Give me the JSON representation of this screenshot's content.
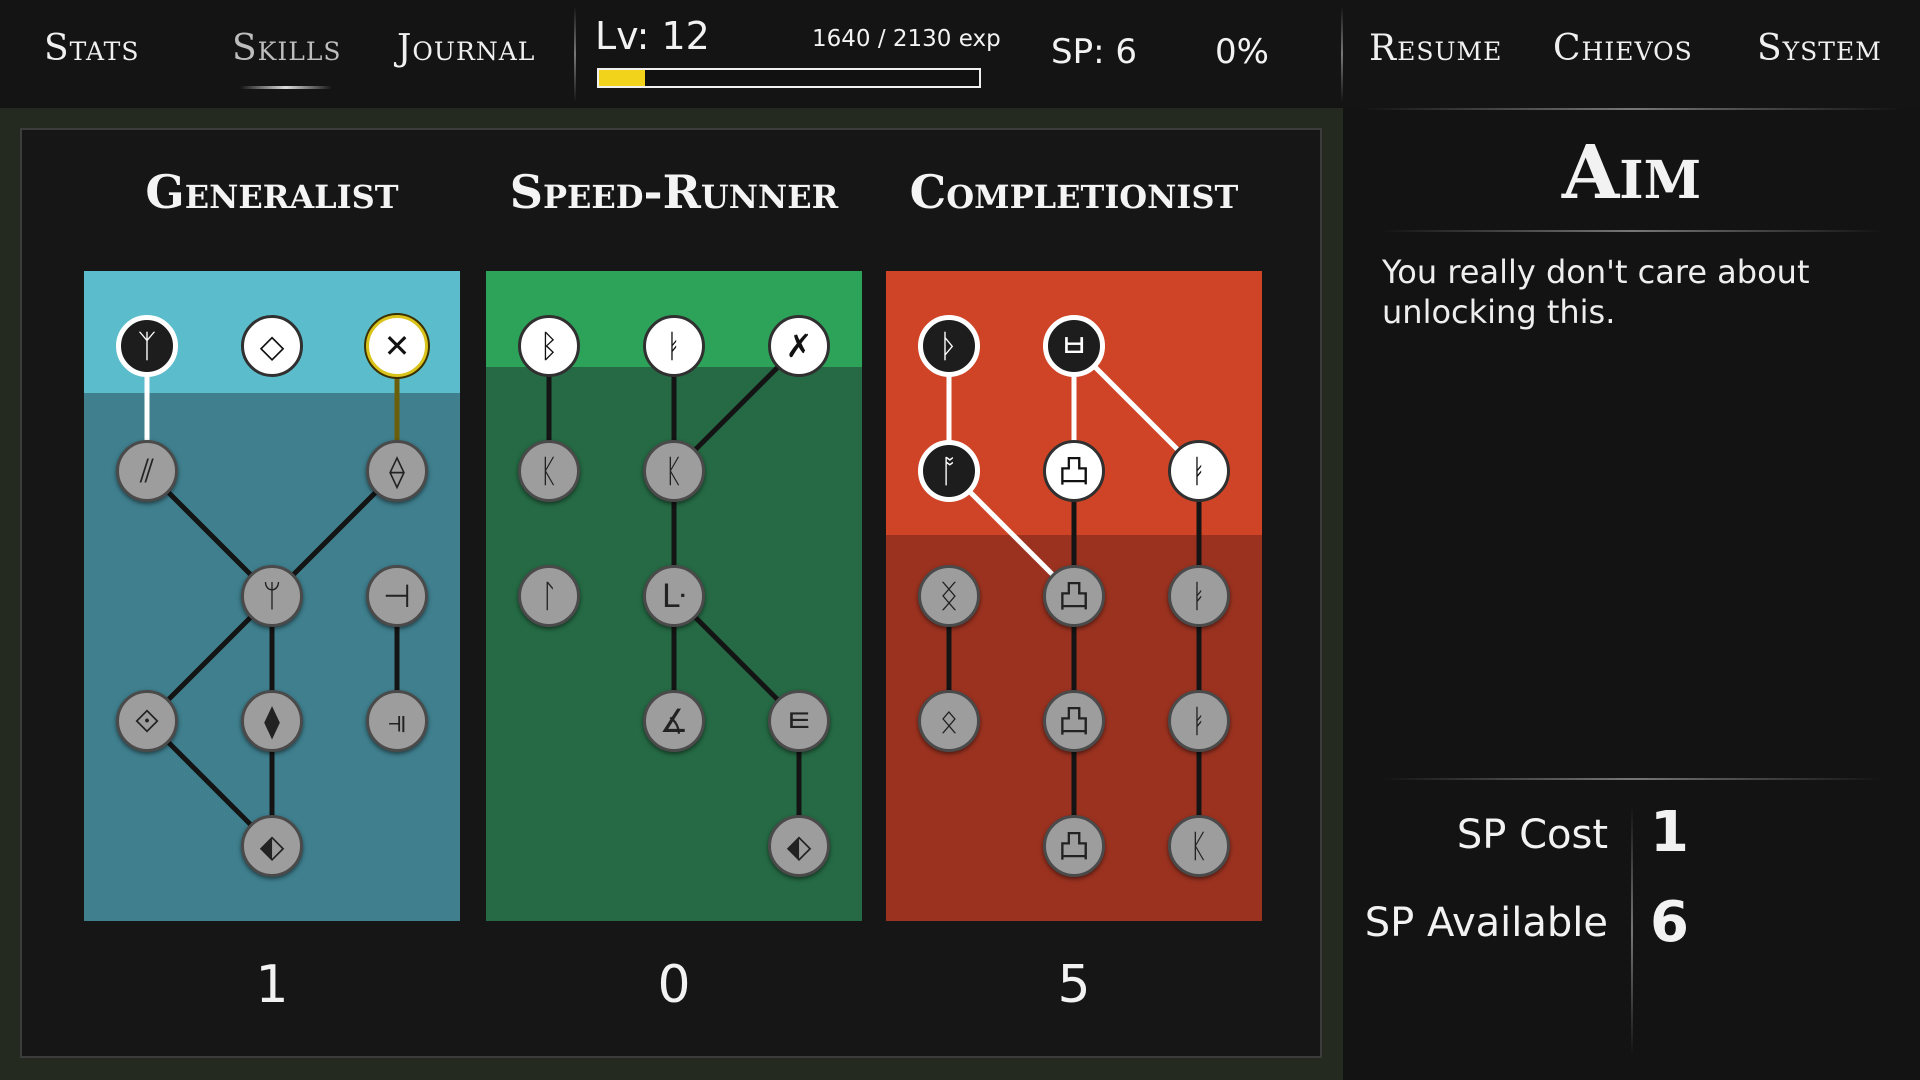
{
  "nav": {
    "stats": "Stats",
    "skills": "Skills",
    "journal": "Journal",
    "resume": "Resume",
    "chievos": "Chievos",
    "system": "System"
  },
  "status": {
    "level": "Lv: 12",
    "exp_text": "1640 / 2130 exp",
    "exp_fraction": 0.12,
    "sp": "SP: 6",
    "percent": "0%",
    "bar_color": "#f2d31b"
  },
  "trees": [
    {
      "title": "Generalist",
      "count": "1",
      "top_color": "#5bbdcc",
      "body_color": "#3f7f8e",
      "band_height": 122,
      "nodes": [
        {
          "id": "g1",
          "col": 0,
          "row": 0,
          "state": "unlocked",
          "icon": "rune-psi-icon",
          "glyph": "ᛉ"
        },
        {
          "id": "g2",
          "col": 1,
          "row": 0,
          "state": "available",
          "icon": "rune-diamond-icon",
          "glyph": "◇"
        },
        {
          "id": "g3",
          "col": 2,
          "row": 0,
          "state": "selected",
          "icon": "rune-cross-icon",
          "glyph": "✕"
        },
        {
          "id": "g4",
          "col": 0,
          "row": 1,
          "state": "locked",
          "icon": "rune-slashes-icon",
          "glyph": "⫽"
        },
        {
          "id": "g5",
          "col": 2,
          "row": 1,
          "state": "locked",
          "icon": "rune-diamond-hatched-icon",
          "glyph": "⟠"
        },
        {
          "id": "g6",
          "col": 1,
          "row": 2,
          "state": "locked",
          "icon": "rune-fork-icon",
          "glyph": "ᛘ"
        },
        {
          "id": "g7",
          "col": 2,
          "row": 2,
          "state": "locked",
          "icon": "rune-tee-icon",
          "glyph": "⊣"
        },
        {
          "id": "g8",
          "col": 0,
          "row": 3,
          "state": "locked",
          "icon": "rune-diamond-cross-icon",
          "glyph": "⟐"
        },
        {
          "id": "g9",
          "col": 1,
          "row": 3,
          "state": "locked",
          "icon": "rune-diamond-bars-icon",
          "glyph": "⧫"
        },
        {
          "id": "g10",
          "col": 2,
          "row": 3,
          "state": "locked",
          "icon": "rune-double-tee-icon",
          "glyph": "⫣"
        },
        {
          "id": "g11",
          "col": 1,
          "row": 4,
          "state": "locked",
          "icon": "rune-diamond-slash-icon",
          "glyph": "⬖"
        }
      ],
      "links": [
        [
          "g1",
          "g4"
        ],
        [
          "g3",
          "g5"
        ],
        [
          "g4",
          "g6"
        ],
        [
          "g5",
          "g6"
        ],
        [
          "g6",
          "g8"
        ],
        [
          "g6",
          "g9"
        ],
        [
          "g7",
          "g10"
        ],
        [
          "g9",
          "g11"
        ],
        [
          "g8",
          "g11"
        ]
      ],
      "active_links": [
        [
          "g1",
          "g4"
        ]
      ],
      "selected_links": [
        [
          "g3",
          "g5"
        ]
      ]
    },
    {
      "title": "Speed-Runner",
      "count": "0",
      "top_color": "#2da35a",
      "body_color": "#256a44",
      "band_height": 96,
      "nodes": [
        {
          "id": "s1",
          "col": 0,
          "row": 0,
          "state": "available",
          "icon": "rune-beta-icon",
          "glyph": "ᛒ"
        },
        {
          "id": "s2",
          "col": 1,
          "row": 0,
          "state": "available",
          "icon": "rune-six-icon",
          "glyph": "ᛓ"
        },
        {
          "id": "s3",
          "col": 2,
          "row": 0,
          "state": "available",
          "icon": "rune-star-icon",
          "glyph": "✗"
        },
        {
          "id": "s4",
          "col": 0,
          "row": 1,
          "state": "locked",
          "icon": "rune-k-icon",
          "glyph": "ᛕ"
        },
        {
          "id": "s5",
          "col": 1,
          "row": 1,
          "state": "locked",
          "icon": "rune-kx-icon",
          "glyph": "ᛕ"
        },
        {
          "id": "s6",
          "col": 0,
          "row": 2,
          "state": "locked",
          "icon": "rune-hook-icon",
          "glyph": "ᛚ"
        },
        {
          "id": "s7",
          "col": 1,
          "row": 2,
          "state": "locked",
          "icon": "rune-corner-icon",
          "glyph": "ᒷ"
        },
        {
          "id": "s8",
          "col": 1,
          "row": 3,
          "state": "locked",
          "icon": "rune-angle-icon",
          "glyph": "∡"
        },
        {
          "id": "s9",
          "col": 2,
          "row": 3,
          "state": "locked",
          "icon": "rune-box-e-icon",
          "glyph": "ㅌ"
        },
        {
          "id": "s10",
          "col": 2,
          "row": 4,
          "state": "locked",
          "icon": "rune-diamond-slash-icon",
          "glyph": "⬖"
        }
      ],
      "links": [
        [
          "s1",
          "s4"
        ],
        [
          "s2",
          "s5"
        ],
        [
          "s3",
          "s5"
        ],
        [
          "s5",
          "s7"
        ],
        [
          "s7",
          "s8"
        ],
        [
          "s7",
          "s9"
        ],
        [
          "s9",
          "s10"
        ]
      ],
      "active_links": [],
      "selected_links": []
    },
    {
      "title": "Completionist",
      "count": "5",
      "top_color": "#cf4426",
      "body_color": "#9b3220",
      "band_height": 264,
      "nodes": [
        {
          "id": "c1",
          "col": 0,
          "row": 0,
          "state": "unlocked",
          "icon": "rune-hook-icon",
          "glyph": "ᚦ"
        },
        {
          "id": "c2",
          "col": 1,
          "row": 0,
          "state": "unlocked",
          "icon": "rune-box-u-icon",
          "glyph": "ㅂ"
        },
        {
          "id": "c3",
          "col": 0,
          "row": 1,
          "state": "unlocked",
          "icon": "rune-hook-arrow-icon",
          "glyph": "ᚩ"
        },
        {
          "id": "c4",
          "col": 1,
          "row": 1,
          "state": "available",
          "icon": "rune-box-flag-icon",
          "glyph": "凸"
        },
        {
          "id": "c5",
          "col": 2,
          "row": 1,
          "state": "available",
          "icon": "rune-six-icon",
          "glyph": "ᛓ"
        },
        {
          "id": "c6",
          "col": 0,
          "row": 2,
          "state": "locked",
          "icon": "rune-hourglass-icon",
          "glyph": "ᛝ"
        },
        {
          "id": "c7",
          "col": 1,
          "row": 2,
          "state": "locked",
          "icon": "rune-box-flag-x-icon",
          "glyph": "凸"
        },
        {
          "id": "c8",
          "col": 2,
          "row": 2,
          "state": "locked",
          "icon": "rune-six-bar-icon",
          "glyph": "ᛓ"
        },
        {
          "id": "c9",
          "col": 0,
          "row": 3,
          "state": "locked",
          "icon": "rune-diamond-x-icon",
          "glyph": "ᛟ"
        },
        {
          "id": "c10",
          "col": 1,
          "row": 3,
          "state": "locked",
          "icon": "rune-box-flag-slash-icon",
          "glyph": "凸"
        },
        {
          "id": "c11",
          "col": 2,
          "row": 3,
          "state": "locked",
          "icon": "rune-six-slash-icon",
          "glyph": "ᛓ"
        },
        {
          "id": "c12",
          "col": 1,
          "row": 4,
          "state": "locked",
          "icon": "rune-box-flag-dot-icon",
          "glyph": "凸"
        },
        {
          "id": "c13",
          "col": 2,
          "row": 4,
          "state": "locked",
          "icon": "rune-box-k-icon",
          "glyph": "ᛕ"
        }
      ],
      "links": [
        [
          "c1",
          "c3"
        ],
        [
          "c2",
          "c4"
        ],
        [
          "c2",
          "c5"
        ],
        [
          "c3",
          "c7"
        ],
        [
          "c4",
          "c7"
        ],
        [
          "c5",
          "c8"
        ],
        [
          "c6",
          "c9"
        ],
        [
          "c7",
          "c10"
        ],
        [
          "c8",
          "c11"
        ],
        [
          "c10",
          "c12"
        ],
        [
          "c11",
          "c13"
        ]
      ],
      "active_links": [
        [
          "c1",
          "c3"
        ],
        [
          "c2",
          "c4"
        ],
        [
          "c2",
          "c5"
        ],
        [
          "c3",
          "c7"
        ]
      ],
      "selected_links": []
    }
  ],
  "detail": {
    "title": "Aim",
    "description": "You really don't care about unlocking this.",
    "sp_cost_label": "SP Cost",
    "sp_cost_value": "1",
    "sp_available_label": "SP Available",
    "sp_available_value": "6"
  }
}
